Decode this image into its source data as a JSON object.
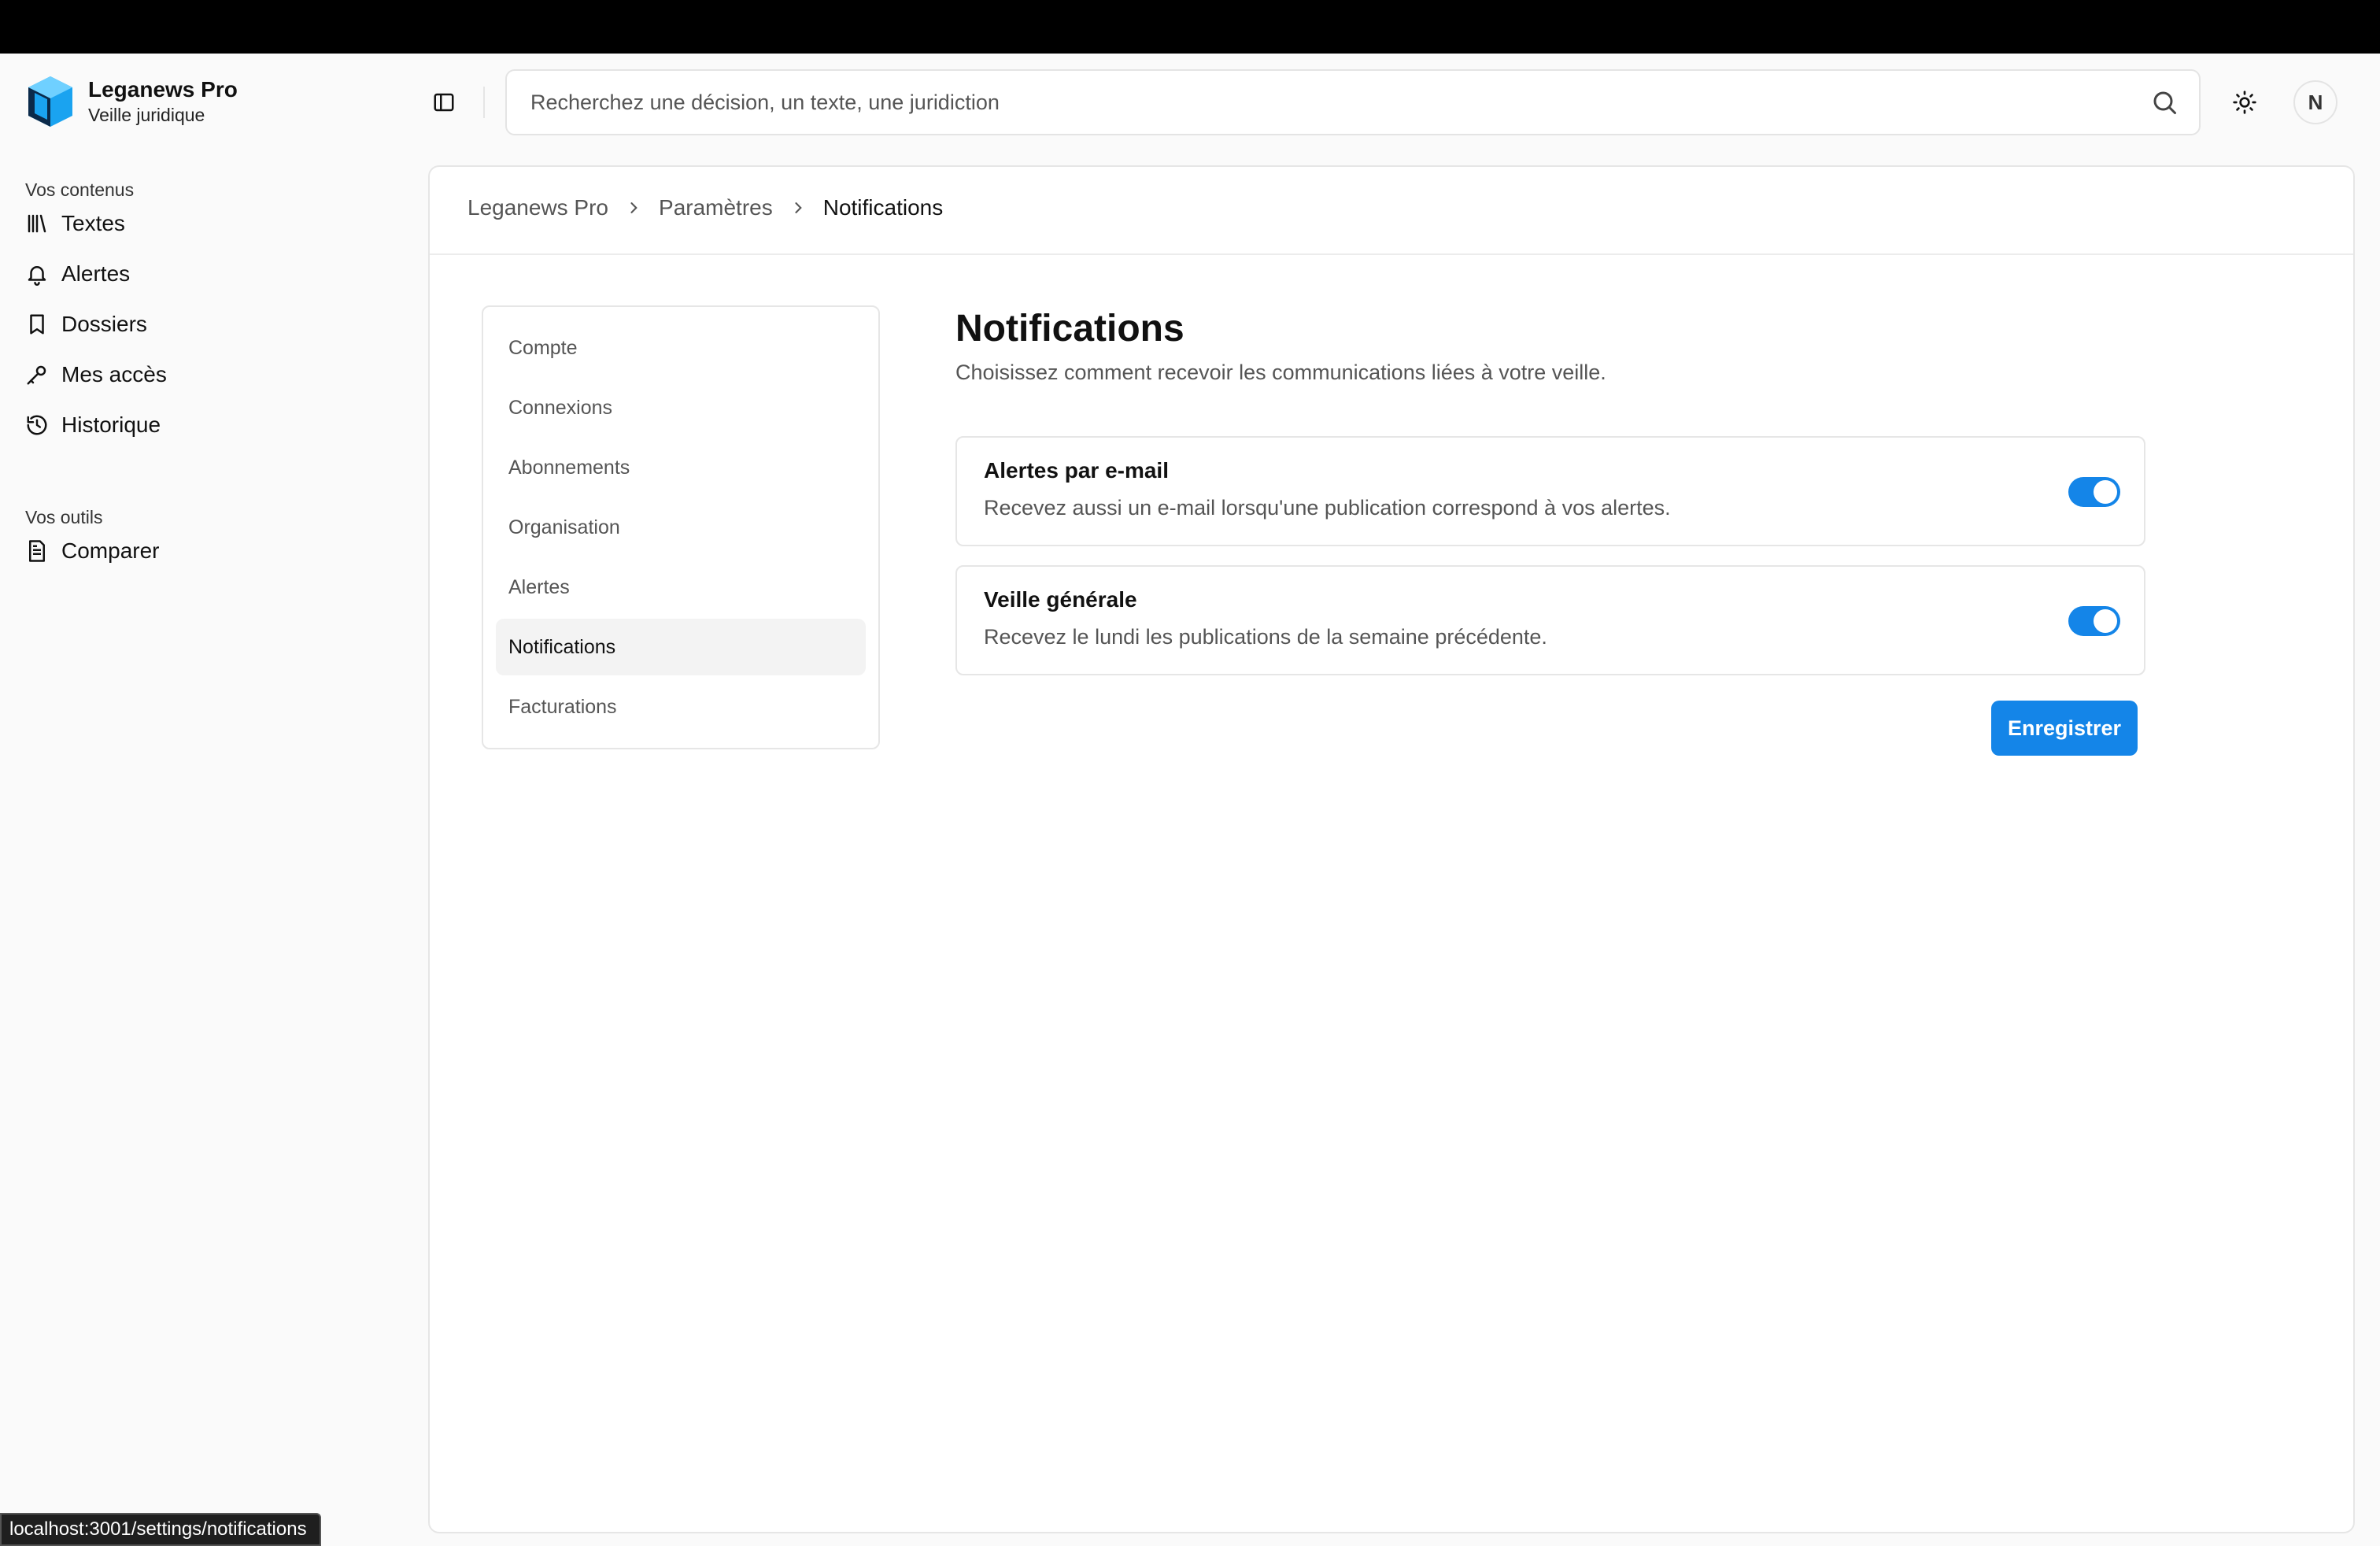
{
  "brand": {
    "title": "Leganews Pro",
    "subtitle": "Veille juridique"
  },
  "sidebar": {
    "section1": "Vos contenus",
    "items1": [
      {
        "label": "Textes",
        "icon": "library-icon"
      },
      {
        "label": "Alertes",
        "icon": "bell-icon"
      },
      {
        "label": "Dossiers",
        "icon": "bookmark-icon"
      },
      {
        "label": "Mes accès",
        "icon": "key-icon"
      },
      {
        "label": "Historique",
        "icon": "history-icon"
      }
    ],
    "section2": "Vos outils",
    "items2": [
      {
        "label": "Comparer",
        "icon": "document-icon"
      }
    ]
  },
  "search": {
    "placeholder": "Recherchez une décision, un texte, une juridiction",
    "value": ""
  },
  "user": {
    "initial": "N"
  },
  "breadcrumb": [
    "Leganews Pro",
    "Paramètres",
    "Notifications"
  ],
  "settings_nav": {
    "items": [
      "Compte",
      "Connexions",
      "Abonnements",
      "Organisation",
      "Alertes",
      "Notifications",
      "Facturations"
    ],
    "active": "Notifications"
  },
  "content": {
    "title": "Notifications",
    "description": "Choisissez comment recevoir les communications liées à votre veille.",
    "options": [
      {
        "title": "Alertes par e-mail",
        "description": "Recevez aussi un e-mail lorsqu'une publication correspond à vos alertes.",
        "enabled": true
      },
      {
        "title": "Veille générale",
        "description": "Recevez le lundi les publications de la semaine précédente.",
        "enabled": true
      }
    ],
    "save_label": "Enregistrer"
  },
  "status_url": "localhost:3001/settings/notifications",
  "colors": {
    "accent": "#1485e8",
    "logo_primary": "#1aa3f0",
    "logo_dark": "#0b2a4a"
  }
}
